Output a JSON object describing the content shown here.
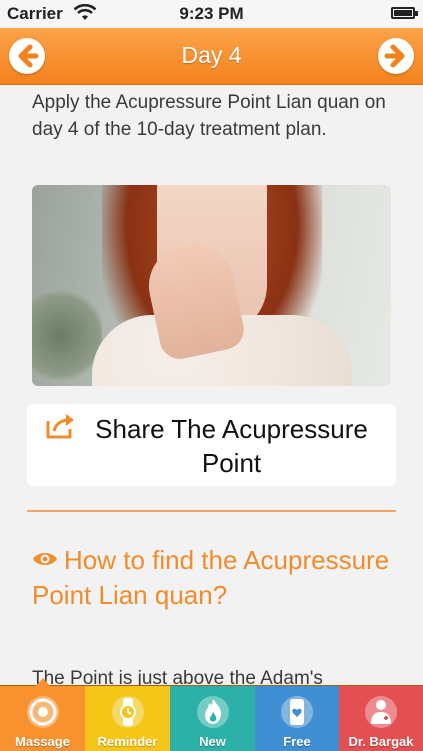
{
  "status_bar": {
    "carrier": "Carrier",
    "time": "9:23 PM"
  },
  "navbar": {
    "title": "Day 4"
  },
  "intro_text": "Apply the Acupressure Point Lian quan on day 4 of the 10-day treatment plan.",
  "share": {
    "label": "Share The Acupressure Point"
  },
  "howto": {
    "heading": "How to find the Acupressure Point Lian quan?"
  },
  "point_text": "The Point is just above the Adam's",
  "colors": {
    "accent": "#f3821c",
    "heading": "#f08c2c",
    "tab_massage": "#f7922f",
    "tab_reminder": "#f5c518",
    "tab_new": "#2bb1a7",
    "tab_free": "#3f8fd2",
    "tab_drbargak": "#e44f52"
  },
  "tabs": [
    {
      "label": "Massage",
      "icon": "target-icon",
      "active": true
    },
    {
      "label": "Reminder",
      "icon": "watch-icon",
      "active": false
    },
    {
      "label": "New",
      "icon": "flame-icon",
      "active": false
    },
    {
      "label": "Free",
      "icon": "phone-heart-icon",
      "active": false
    },
    {
      "label": "Dr. Bargak",
      "icon": "doctor-icon",
      "active": false
    }
  ]
}
